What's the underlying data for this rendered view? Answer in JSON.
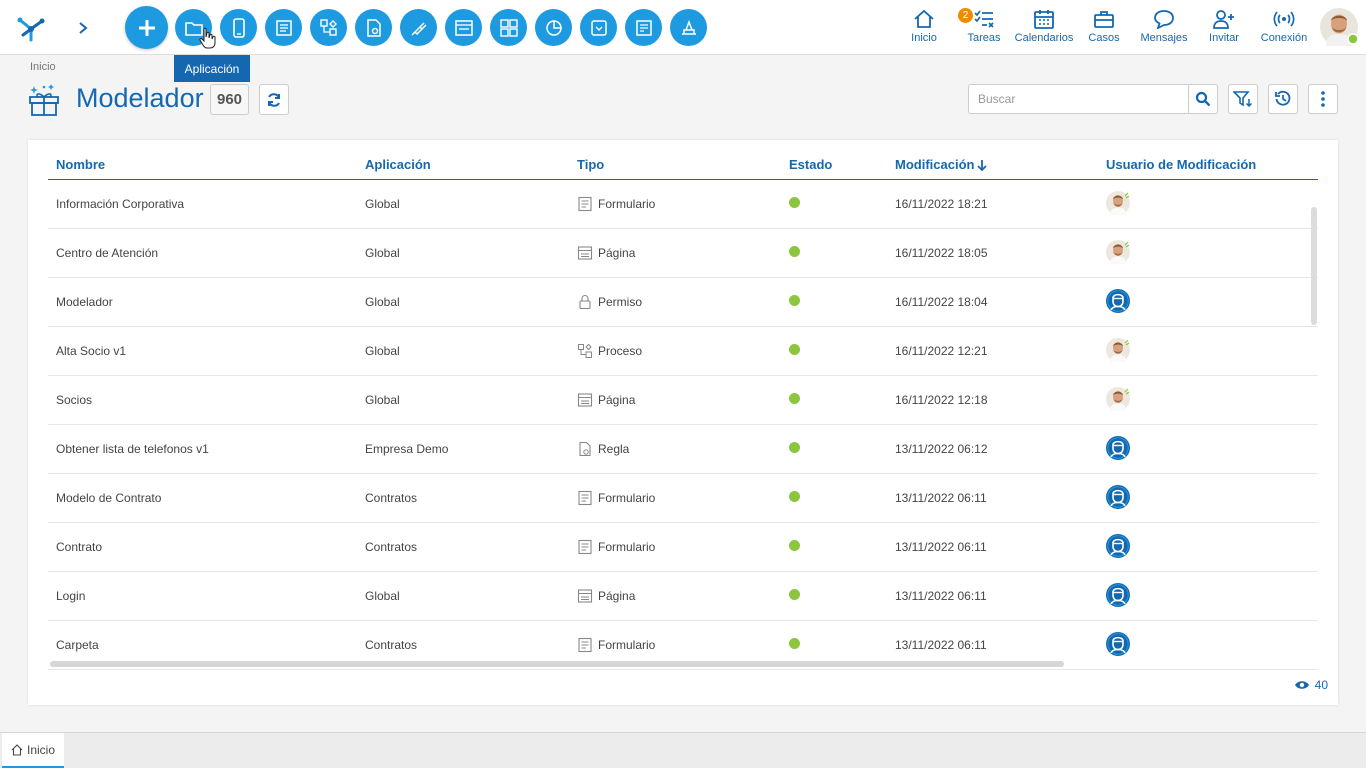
{
  "toolbar": {
    "tools": [
      {
        "name": "application",
        "icon": "folder-icon"
      },
      {
        "name": "mobile",
        "icon": "mobile-icon"
      },
      {
        "name": "form",
        "icon": "form-icon"
      },
      {
        "name": "process",
        "icon": "process-icon"
      },
      {
        "name": "rule",
        "icon": "rule-icon"
      },
      {
        "name": "integration",
        "icon": "plug-icon"
      },
      {
        "name": "page",
        "icon": "page-icon"
      },
      {
        "name": "dashboard",
        "icon": "dashboard-icon"
      },
      {
        "name": "chart",
        "icon": "pie-chart-icon"
      },
      {
        "name": "value-list",
        "icon": "dropdown-icon"
      },
      {
        "name": "report",
        "icon": "report-icon"
      },
      {
        "name": "deploy",
        "icon": "deploy-icon"
      }
    ],
    "tooltip": "Aplicación"
  },
  "menu": {
    "home": "Inicio",
    "tasks": "Tareas",
    "tasks_badge": "2",
    "calendars": "Calendarios",
    "cases": "Casos",
    "messages": "Mensajes",
    "invite": "Invitar",
    "connection": "Conexión"
  },
  "header": {
    "breadcrumb": "Inicio",
    "title": "Modelador",
    "count": "960",
    "search_placeholder": "Buscar"
  },
  "table": {
    "columns": [
      "Nombre",
      "Aplicación",
      "Tipo",
      "Estado",
      "Modificación",
      "Usuario de Modificación"
    ],
    "rows": [
      {
        "name": "Información Corporativa",
        "app": "Global",
        "type": "Formulario",
        "type_icon": "form-icon",
        "date": "16/11/2022 18:21",
        "user": "photo"
      },
      {
        "name": "Centro de Atención",
        "app": "Global",
        "type": "Página",
        "type_icon": "page-icon",
        "date": "16/11/2022 18:05",
        "user": "photo"
      },
      {
        "name": "Modelador",
        "app": "Global",
        "type": "Permiso",
        "type_icon": "lock-icon",
        "date": "16/11/2022 18:04",
        "user": "system"
      },
      {
        "name": "Alta Socio v1",
        "app": "Global",
        "type": "Proceso",
        "type_icon": "process-icon",
        "date": "16/11/2022 12:21",
        "user": "photo"
      },
      {
        "name": "Socios",
        "app": "Global",
        "type": "Página",
        "type_icon": "page-icon",
        "date": "16/11/2022 12:18",
        "user": "photo"
      },
      {
        "name": "Obtener lista de telefonos v1",
        "app": "Empresa Demo",
        "type": "Regla",
        "type_icon": "rule-icon",
        "date": "13/11/2022 06:12",
        "user": "system"
      },
      {
        "name": "Modelo de Contrato",
        "app": "Contratos",
        "type": "Formulario",
        "type_icon": "form-icon",
        "date": "13/11/2022 06:11",
        "user": "system"
      },
      {
        "name": "Contrato",
        "app": "Contratos",
        "type": "Formulario",
        "type_icon": "form-icon",
        "date": "13/11/2022 06:11",
        "user": "system"
      },
      {
        "name": "Login",
        "app": "Global",
        "type": "Página",
        "type_icon": "page-icon",
        "date": "13/11/2022 06:11",
        "user": "system"
      },
      {
        "name": "Carpeta",
        "app": "Contratos",
        "type": "Formulario",
        "type_icon": "form-icon",
        "date": "13/11/2022 06:11",
        "user": "system"
      }
    ],
    "visible_count": "40"
  },
  "tabs": {
    "home": "Inicio"
  },
  "colors": {
    "primary": "#1568b0",
    "tool_button": "#1e9be0",
    "status_active": "#8cc63f",
    "badge": "#f08c00"
  }
}
